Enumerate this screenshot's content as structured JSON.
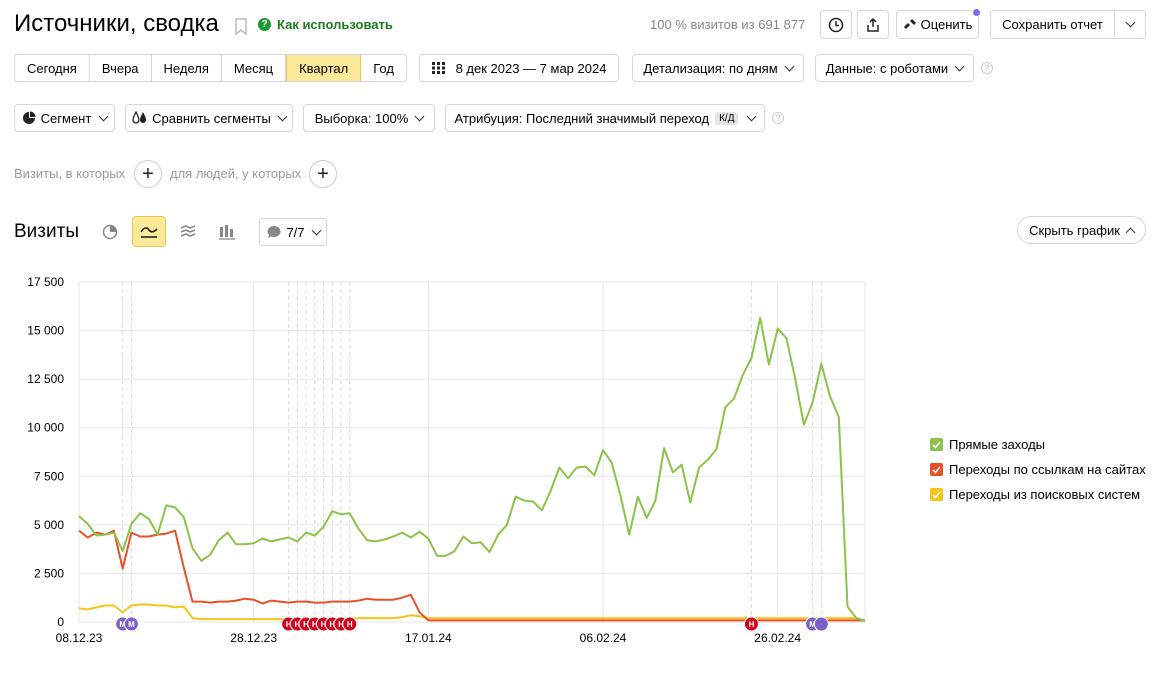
{
  "header": {
    "title": "Источники, сводка",
    "howto_label": "Как использовать",
    "visits_info": "100 % визитов из 691 877",
    "rate_label": "Оценить",
    "save_report_label": "Сохранить отчет"
  },
  "periods": {
    "tabs": [
      "Сегодня",
      "Вчера",
      "Неделя",
      "Месяц",
      "Квартал",
      "Год"
    ],
    "active": "Квартал",
    "date_range": "8 дек 2023 — 7 мар 2024",
    "detail_label": "Детализация: по дням",
    "data_label": "Данные: с роботами"
  },
  "segments": {
    "segment_label": "Сегмент",
    "compare_label": "Сравнить сегменты",
    "sample_label": "Выборка: 100%",
    "attribution_label": "Атрибуция: Последний значимый переход",
    "attribution_badge": "К/Д"
  },
  "filters": {
    "visits_label": "Визиты, в которых",
    "people_label": "для людей, у которых"
  },
  "chart_section": {
    "title": "Визиты",
    "annotations_count": "7/7",
    "hide_chart_label": "Скрыть график"
  },
  "colors": {
    "accent": "#fde99a",
    "green": "#8bc34a",
    "red": "#e8502a",
    "yellow": "#f5c518",
    "marker_red": "#d0021b",
    "marker_purple": "#7a5fc8"
  },
  "chart_data": {
    "type": "line",
    "ylim": [
      0,
      17500
    ],
    "yticks": [
      "0",
      "2 500",
      "5 000",
      "7 500",
      "10 000",
      "12 500",
      "15 000",
      "17 500"
    ],
    "x_tick_labels": [
      "08.12.23",
      "28.12.23",
      "17.01.24",
      "06.02.24",
      "26.02.24"
    ],
    "x_tick_index": [
      0,
      20,
      40,
      60,
      80
    ],
    "num_days": 91,
    "legend_position": "right",
    "series": [
      {
        "name": "Прямые заходы",
        "color": "#8bc34a",
        "values": [
          5450,
          5050,
          4450,
          4500,
          4600,
          3650,
          5050,
          5600,
          5300,
          4500,
          6000,
          5900,
          5400,
          3800,
          3150,
          3450,
          4200,
          4600,
          4000,
          4000,
          4050,
          4300,
          4150,
          4250,
          4350,
          4150,
          4600,
          4450,
          4900,
          5700,
          5550,
          5600,
          4800,
          4200,
          4150,
          4250,
          4400,
          4600,
          4350,
          4650,
          4300,
          3400,
          3400,
          3650,
          4400,
          4050,
          4100,
          3600,
          4500,
          5000,
          6450,
          6250,
          6200,
          5750,
          6750,
          7950,
          7400,
          7950,
          8000,
          7550,
          8850,
          8200,
          6500,
          4500,
          6450,
          5350,
          6250,
          8950,
          7700,
          8100,
          6150,
          7950,
          8350,
          8900,
          11050,
          11500,
          12700,
          13600,
          15650,
          13250,
          15100,
          14600,
          12550,
          10150,
          11300,
          13300,
          11600,
          10550,
          800,
          200,
          50
        ],
        "points": []
      },
      {
        "name": "Переходы по ссылкам на сайтах",
        "color": "#e8502a",
        "values": [
          4700,
          4350,
          4600,
          4500,
          4700,
          2750,
          4600,
          4400,
          4400,
          4500,
          4550,
          4700,
          2800,
          1050,
          1050,
          1000,
          1050,
          1050,
          1100,
          1200,
          1150,
          950,
          1100,
          1050,
          1000,
          1050,
          1050,
          1000,
          1000,
          1050,
          1050,
          1050,
          1100,
          1200,
          1150,
          1150,
          1150,
          1250,
          1400,
          500,
          80,
          80,
          80,
          80,
          80,
          80,
          80,
          80,
          80,
          80,
          80,
          80,
          80,
          80,
          80,
          80,
          80,
          80,
          80,
          80,
          80,
          80,
          80,
          80,
          80,
          80,
          80,
          80,
          80,
          80,
          80,
          80,
          80,
          80,
          80,
          80,
          80,
          80,
          80,
          80,
          80,
          80,
          80,
          80,
          80,
          80,
          80,
          80,
          80,
          80,
          80
        ],
        "points": []
      },
      {
        "name": "Переходы из поисковых систем",
        "color": "#f5c518",
        "values": [
          700,
          650,
          750,
          850,
          850,
          500,
          850,
          900,
          900,
          850,
          850,
          750,
          800,
          200,
          150,
          150,
          150,
          150,
          150,
          150,
          150,
          150,
          150,
          150,
          150,
          150,
          150,
          150,
          150,
          150,
          200,
          200,
          200,
          200,
          200,
          200,
          200,
          250,
          350,
          300,
          200,
          200,
          200,
          200,
          200,
          200,
          200,
          200,
          200,
          200,
          200,
          200,
          200,
          200,
          200,
          200,
          200,
          200,
          200,
          200,
          200,
          200,
          200,
          200,
          200,
          200,
          200,
          200,
          200,
          200,
          200,
          200,
          200,
          200,
          200,
          200,
          200,
          200,
          200,
          200,
          200,
          200,
          200,
          200,
          200,
          200,
          200,
          200,
          200,
          200,
          50
        ],
        "points": []
      }
    ],
    "annotation_markers": [
      {
        "label": "М",
        "color": "#7a5fc8",
        "day": 5
      },
      {
        "label": "М",
        "color": "#7a5fc8",
        "day": 6
      },
      {
        "label": "Н",
        "color": "#d0021b",
        "day": 24
      },
      {
        "label": "Н",
        "color": "#d0021b",
        "day": 25
      },
      {
        "label": "Н",
        "color": "#d0021b",
        "day": 26
      },
      {
        "label": "Н",
        "color": "#d0021b",
        "day": 27
      },
      {
        "label": "Н",
        "color": "#d0021b",
        "day": 28
      },
      {
        "label": "Н",
        "color": "#d0021b",
        "day": 29
      },
      {
        "label": "Н",
        "color": "#d0021b",
        "day": 30
      },
      {
        "label": "Н",
        "color": "#d0021b",
        "day": 31
      },
      {
        "label": "Н",
        "color": "#d0021b",
        "day": 77
      },
      {
        "label": "М",
        "color": "#7a5fc8",
        "day": 84
      },
      {
        "label": "",
        "color": "#7a5fc8",
        "day": 85
      }
    ]
  }
}
